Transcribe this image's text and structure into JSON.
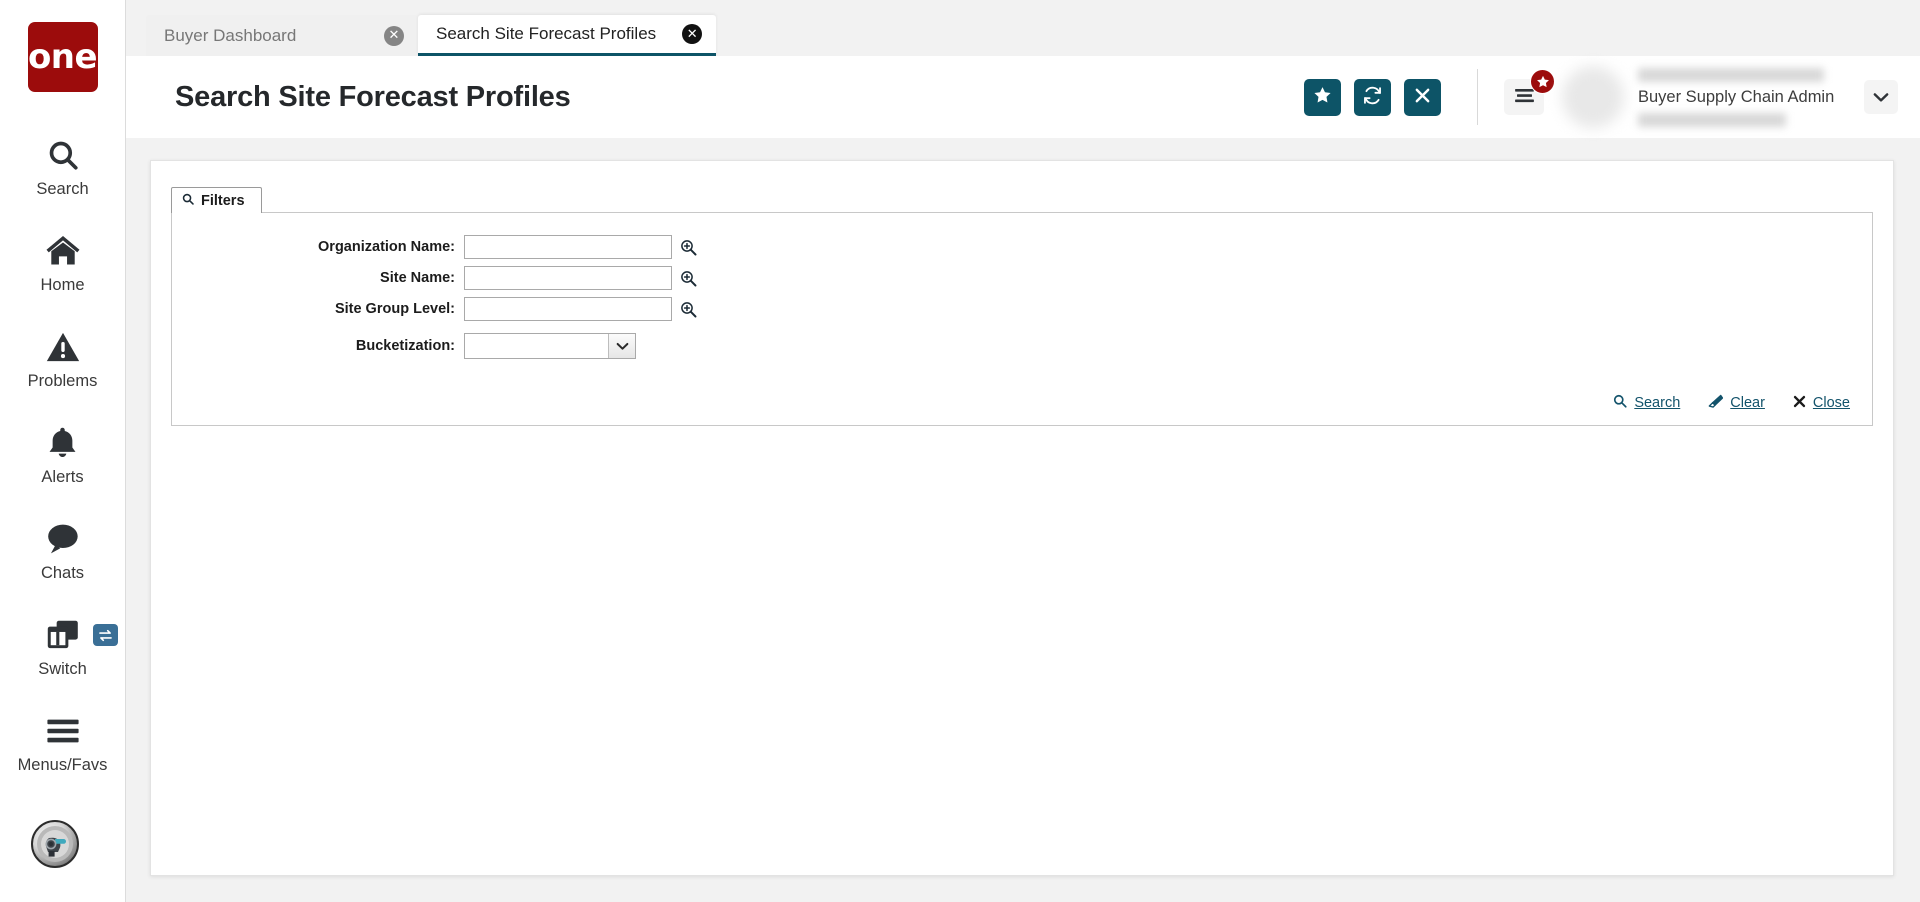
{
  "app": {
    "logo_text": "one",
    "logo_color": "#9c0c0c",
    "accent_color": "#0d5467"
  },
  "sidebar": {
    "items": [
      {
        "label": "Search",
        "icon": "search-icon"
      },
      {
        "label": "Home",
        "icon": "home-icon"
      },
      {
        "label": "Problems",
        "icon": "warning-triangle-icon"
      },
      {
        "label": "Alerts",
        "icon": "bell-icon"
      },
      {
        "label": "Chats",
        "icon": "chat-bubble-icon"
      },
      {
        "label": "Switch",
        "icon": "windows-switch-icon",
        "badge_icon": "exchange-arrows-icon"
      },
      {
        "label": "Menus/Favs",
        "icon": "hamburger-icon"
      }
    ],
    "bottom_avatar_icon": "assistant-bot-avatar-icon"
  },
  "tabs": [
    {
      "label": "Buyer Dashboard",
      "active": false,
      "close_icon": "close-circle-icon"
    },
    {
      "label": "Search Site Forecast Profiles",
      "active": true,
      "close_icon": "close-circle-icon"
    }
  ],
  "header": {
    "title": "Search Site Forecast Profiles",
    "buttons": [
      {
        "name": "favorite-button",
        "icon": "star-icon"
      },
      {
        "name": "refresh-button",
        "icon": "refresh-icon"
      },
      {
        "name": "close-button",
        "icon": "x-icon"
      }
    ],
    "menu_button": {
      "icon": "hamburger-icon",
      "badge_icon": "star-icon"
    },
    "user": {
      "name_masked": "",
      "role": "Buyer Supply Chain Admin",
      "email_masked": "",
      "caret_icon": "chevron-down-icon"
    }
  },
  "filters": {
    "tab_label": "Filters",
    "tab_icon": "search-icon",
    "fields": [
      {
        "label": "Organization Name:",
        "value": "",
        "placeholder": "",
        "type": "lookup",
        "icon": "magnifier-plus-icon"
      },
      {
        "label": "Site Name:",
        "value": "",
        "placeholder": "",
        "type": "lookup",
        "icon": "magnifier-plus-icon"
      },
      {
        "label": "Site Group Level:",
        "value": "",
        "placeholder": "",
        "type": "lookup",
        "icon": "magnifier-plus-icon"
      },
      {
        "label": "Bucketization:",
        "value": "",
        "type": "select",
        "icon": "chevron-down-icon",
        "options": []
      }
    ],
    "actions": [
      {
        "label": "Search",
        "icon": "search-icon"
      },
      {
        "label": "Clear",
        "icon": "eraser-icon"
      },
      {
        "label": "Close",
        "icon": "x-icon"
      }
    ]
  }
}
